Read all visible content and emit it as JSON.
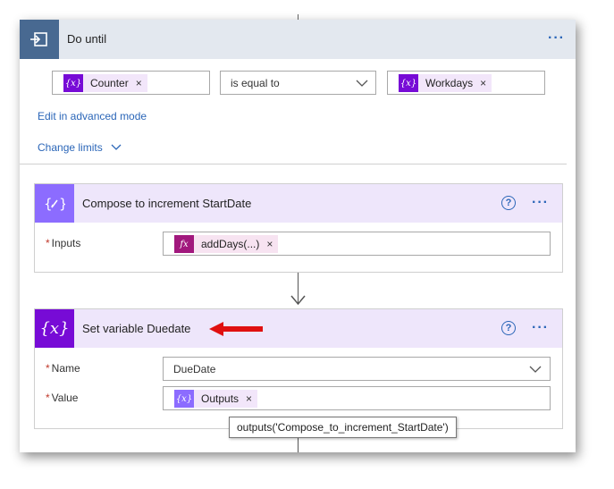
{
  "do_until": {
    "title": "Do until",
    "condition": {
      "left_token": "Counter",
      "operator": "is equal to",
      "right_token": "Workdays"
    },
    "edit_advanced_link": "Edit in advanced mode",
    "change_limits_link": "Change limits"
  },
  "compose_action": {
    "title": "Compose to increment StartDate",
    "inputs_label": "Inputs",
    "inputs_token": "addDays(...)"
  },
  "set_variable_action": {
    "title": "Set variable Duedate",
    "name_label": "Name",
    "name_value": "DueDate",
    "value_label": "Value",
    "value_token": "Outputs",
    "tooltip": "outputs('Compose_to_increment_StartDate')"
  },
  "symbols": {
    "required_marker": "*",
    "remove": "×",
    "more": "···",
    "help": "?",
    "var_glyph": "{x}",
    "fx_glyph": "fx"
  },
  "colors": {
    "loop_accent": "#486991",
    "variable_accent": "#770bd6",
    "compose_accent": "#8c6cff",
    "expression_accent": "#a1187d",
    "link": "#2b66b8",
    "annotation_arrow": "#e01010"
  }
}
